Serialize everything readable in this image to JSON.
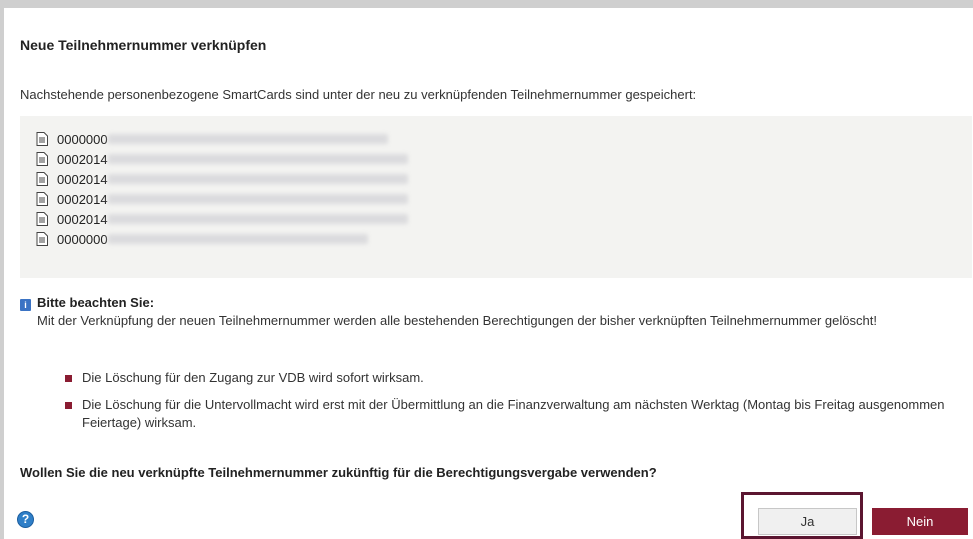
{
  "dialog": {
    "title": "Neue Teilnehmernummer verknüpfen",
    "intro": "Nachstehende personenbezogene SmartCards sind unter der neu zu verknüpfenden Teilnehmernummer gespeichert:"
  },
  "smartcards": [
    {
      "number": "0000000"
    },
    {
      "number": "0002014"
    },
    {
      "number": "0002014"
    },
    {
      "number": "0002014"
    },
    {
      "number": "0002014"
    },
    {
      "number": "0000000"
    }
  ],
  "notice": {
    "heading": "Bitte beachten Sie:",
    "text": "Mit der Verknüpfung der neuen Teilnehmernummer werden alle bestehenden Berechtigungen der bisher verknüpften Teilnehmernummer gelöscht!",
    "bullets": [
      "Die Löschung für den Zugang zur VDB wird sofort wirksam.",
      "Die Löschung für die Untervollmacht wird erst mit der Übermittlung an die Finanzverwaltung am nächsten Werktag (Montag bis Freitag ausgenommen Feiertage) wirksam."
    ]
  },
  "question": "Wollen Sie die neu verknüpfte Teilnehmernummer zukünftig für die Berechtigungsvergabe verwenden?",
  "buttons": {
    "yes": "Ja",
    "no": "Nein"
  },
  "icons": {
    "card": "document-icon",
    "info": "info-icon",
    "help": "help-icon"
  },
  "colors": {
    "accent": "#8a1c32",
    "info": "#3b73c4"
  }
}
